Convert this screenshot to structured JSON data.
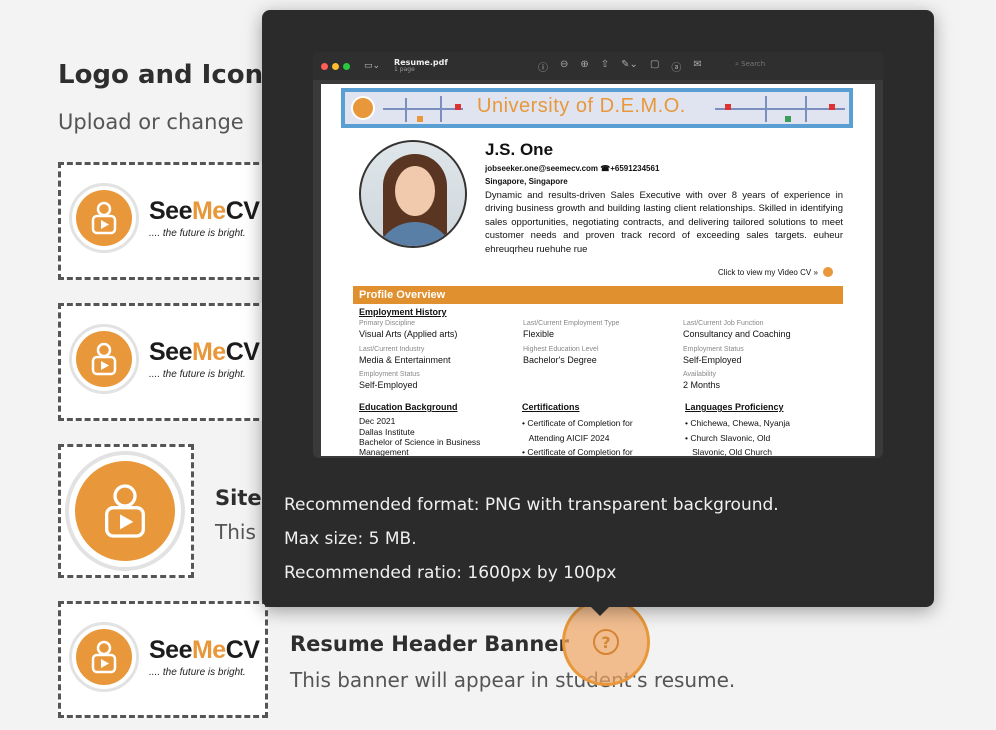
{
  "page": {
    "section_title": "Logo and Icon",
    "section_subtitle": "Upload or change"
  },
  "brand": {
    "name_part1": "See",
    "name_part2": "Me",
    "name_part3": "CV",
    "tagline": ".... the future is bright."
  },
  "rows": {
    "site_title": "Site",
    "site_desc": "This",
    "resume_banner_title": "Resume Header Banner",
    "resume_banner_desc": "This banner will appear in student's resume."
  },
  "help": {
    "icon": "question-circle-icon",
    "glyph": "?"
  },
  "popover": {
    "format_text": "Recommended format: PNG with transparent background.",
    "size_text": "Max size: 5 MB.",
    "ratio_text": "Recommended ratio: 1600px by 100px"
  },
  "preview": {
    "file_name": "Resume.pdf",
    "page_count": "1 page",
    "search_placeholder": "Search",
    "banner_title": "University of D.E.M.O.",
    "resume": {
      "name": "J.S. One",
      "contact": "jobseeker.one@seemecv.com ☎+6591234561",
      "location": "Singapore, Singapore",
      "summary": "Dynamic and results-driven Sales Executive with over 8 years of experience in driving business growth and building lasting client relationships. Skilled in identifying sales opportunities, negotiating contracts, and delivering tailored solutions to meet customer needs and proven track record of exceeding sales targets. euheur ehreuqrheu ruehuhe rue",
      "video_link": "Click to view my Video CV »",
      "profile_overview": "Profile Overview",
      "employment_history": "Employment History",
      "fields": [
        {
          "label": "Primary Discipline",
          "value": "Visual Arts (Applied arts)"
        },
        {
          "label": "Last/Current Employment Type",
          "value": "Flexible"
        },
        {
          "label": "Last/Current Job Function",
          "value": "Consultancy and Coaching"
        },
        {
          "label": "Last/Current Industry",
          "value": "Media & Entertainment"
        },
        {
          "label": "Highest Education Level",
          "value": "Bachelor's Degree"
        },
        {
          "label": "Employment Status",
          "value": "Self-Employed"
        },
        {
          "label": "Employment Status",
          "value": "Self-Employed"
        },
        {
          "label": "Availability",
          "value": "2 Months"
        }
      ],
      "education_heading": "Education Background",
      "education": [
        "Dec 2021",
        "Dallas Institute",
        "Bachelor of Science in Business",
        "Management"
      ],
      "certifications_heading": "Certifications",
      "certifications": [
        "• Certificate of Completion for",
        "   Attending AICIF 2024",
        "• Certificate of Completion for"
      ],
      "languages_heading": "Languages Proficiency",
      "languages": [
        "• Chichewa, Chewa, Nyanja",
        "• Church Slavonic, Old",
        "   Slavonic, Old Church"
      ]
    }
  },
  "colors": {
    "accent": "#e8983a",
    "popover_bg": "#2b2b2b",
    "banner_border": "#5a9fd4"
  }
}
